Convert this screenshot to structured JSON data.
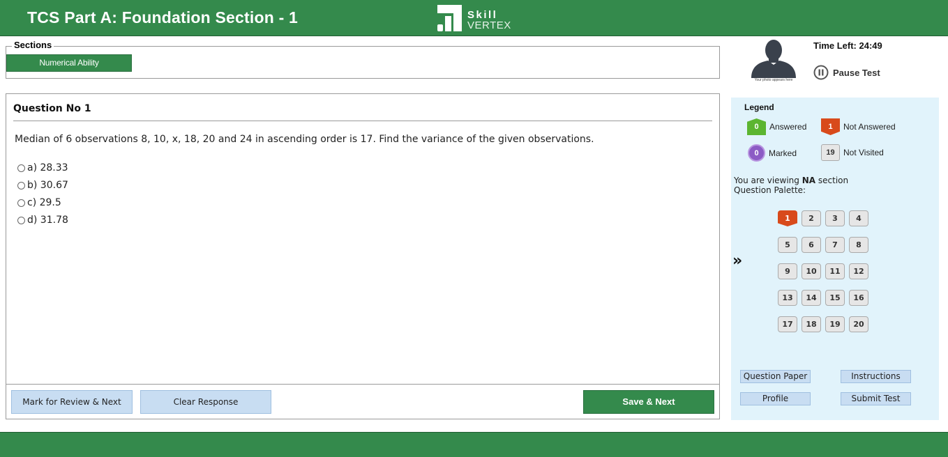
{
  "header": {
    "title": "TCS Part A: Foundation Section - 1",
    "logo_line1": "Skill",
    "logo_line2": "VERTEX"
  },
  "sections": {
    "label": "Sections",
    "tabs": [
      {
        "label": "Numerical Ability"
      }
    ]
  },
  "profile": {
    "caption": "Your photo appears here"
  },
  "timer": {
    "label": "Time Left: 24:49"
  },
  "pause": {
    "label": "Pause Test"
  },
  "question": {
    "title": "Question No 1",
    "text": "Median of 6 observations 8, 10, x, 18, 20 and 24 in ascending order is 17. Find the variance of the given observations.",
    "options": [
      {
        "label": "a) 28.33"
      },
      {
        "label": "b) 30.67"
      },
      {
        "label": "c) 29.5"
      },
      {
        "label": "d) 31.78"
      }
    ]
  },
  "actions": {
    "mark_review": "Mark for Review & Next",
    "clear": "Clear Response",
    "save_next": "Save & Next"
  },
  "legend": {
    "title": "Legend",
    "items": [
      {
        "count": "0",
        "label": "Answered",
        "type": "answered"
      },
      {
        "count": "1",
        "label": "Not Answered",
        "type": "not-answered"
      },
      {
        "count": "0",
        "label": "Marked",
        "type": "marked"
      },
      {
        "count": "19",
        "label": "Not Visited",
        "type": "not-visited"
      }
    ]
  },
  "viewing": {
    "prefix": "You are viewing ",
    "section": "NA",
    "suffix": " section",
    "palette_label": "Question Palette:"
  },
  "palette": {
    "expand_glyph": "»",
    "current": "1",
    "numbers": [
      "1",
      "2",
      "3",
      "4",
      "5",
      "6",
      "7",
      "8",
      "9",
      "10",
      "11",
      "12",
      "13",
      "14",
      "15",
      "16",
      "17",
      "18",
      "19",
      "20"
    ]
  },
  "side_buttons": {
    "question_paper": "Question Paper",
    "instructions": "Instructions",
    "profile": "Profile",
    "submit": "Submit Test"
  },
  "colors": {
    "brand_green": "#348a4c",
    "answered": "#5cb531",
    "not_answered": "#d84a1b",
    "marked": "#8c5bc5",
    "panel_bg": "#e1f3fb",
    "light_button": "#c8ddf2"
  }
}
